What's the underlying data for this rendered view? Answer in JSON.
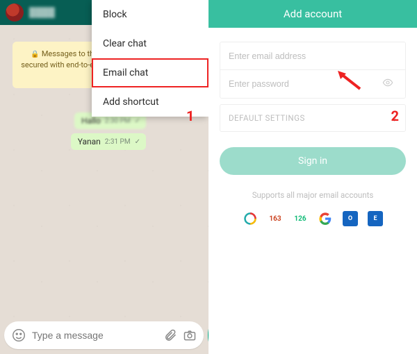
{
  "left": {
    "contact_name": "████",
    "e2e_banner": "Messages to this chat and calls are now secured with end-to-end encryption. Tap for more info.",
    "messages": [
      {
        "text": "Hallo",
        "time": "2:30 PM"
      },
      {
        "text": "Yanan",
        "time": "2:31 PM"
      }
    ],
    "menu": {
      "items": [
        "Block",
        "Clear chat",
        "Email chat",
        "Add shortcut"
      ],
      "highlighted_index": 2
    },
    "input_placeholder": "Type a message",
    "annotation": "1"
  },
  "right": {
    "header": "Add account",
    "email_placeholder": "Enter email address",
    "password_placeholder": "Enter password",
    "default_settings_label": "DEFAULT SETTINGS",
    "signin_label": "Sign in",
    "support_text": "Supports all major email accounts",
    "providers": [
      "qq",
      "163",
      "126",
      "G",
      "O",
      "E"
    ],
    "annotation": "2"
  }
}
